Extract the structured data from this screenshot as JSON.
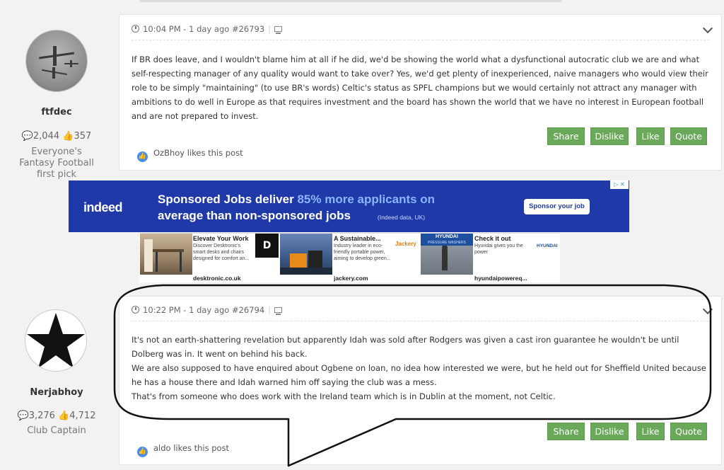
{
  "posts": [
    {
      "author": {
        "name": "ftfdec",
        "posts": "2,044",
        "likes": "357",
        "title": "Everyone's Fantasy Football first pick"
      },
      "meta": {
        "time": "10:04 PM - 1 day ago",
        "id": "#26793"
      },
      "paragraphs": [
        "If BR does leave, and I wouldn't blame him at all if he did, we'd be showing the world what a dysfunctional autocratic club we are and what self-respecting manager of any quality would want to take over? Yes, we'd get plenty of inexperienced, naive managers who would view their role to be simply \"maintaining\" (to use BR's words) Celtic's status as SPFL champions but we would certainly not attract any manager with ambitions to do well in Europe as that requires investment and the board has shown the world that we have no interest in European football and are not prepared to invest."
      ],
      "likes_text": "OzBhoy likes this post"
    },
    {
      "author": {
        "name": "Nerjabhoy",
        "posts": "3,276",
        "likes": "4,712",
        "title": "Club Captain"
      },
      "meta": {
        "time": "10:22 PM - 1 day ago",
        "id": "#26794"
      },
      "paragraphs": [
        "It's not an earth-shattering revelation but apparently Idah was sold after Rodgers was given a cast iron guarantee he wouldn't be until Dolberg was in. It went on behind his back.",
        "We are also supposed to have enquired about Ogbene on loan, no idea how interested we were, but he held out for Sheffield United because he has a house there and Idah warned him off saying the club was a mess.",
        "That's from someone who does work with the Ireland team which is in Dublin at the moment, not Celtic."
      ],
      "likes_text": "aldo likes this post"
    }
  ],
  "buttons": {
    "share": "Share",
    "dislike": "Dislike",
    "like": "Like",
    "quote": "Quote"
  },
  "banner": {
    "logo": "indeed",
    "line1_pre": "Sponsored Jobs deliver ",
    "line1_hl": "85% more applicants on",
    "line2": "average than non-sponsored jobs",
    "source": "(Indeed data, UK)",
    "cta": "Sponsor your job",
    "brand_color": "#1f3aa8"
  },
  "ads": [
    {
      "title": "Elevate Your Work",
      "desc": "Discover Desktronic's smart desks and chairs designed for comfort an...",
      "url": "desktronic.co.uk",
      "logo": "D"
    },
    {
      "title": "A Sustainable...",
      "desc": "Industry leader in eco-friendly portable power, aiming to develop green...",
      "url": "jackery.com",
      "logo": "Jackery"
    },
    {
      "title": "Check it out",
      "desc": "Hyundai gives you the power",
      "url": "hyundaipowereq...",
      "logo": "HYUNDAI",
      "image_label": "HYUNDAI",
      "image_sub": "PRESSURE WASHERS"
    }
  ],
  "accent_color": "#6aa85a"
}
